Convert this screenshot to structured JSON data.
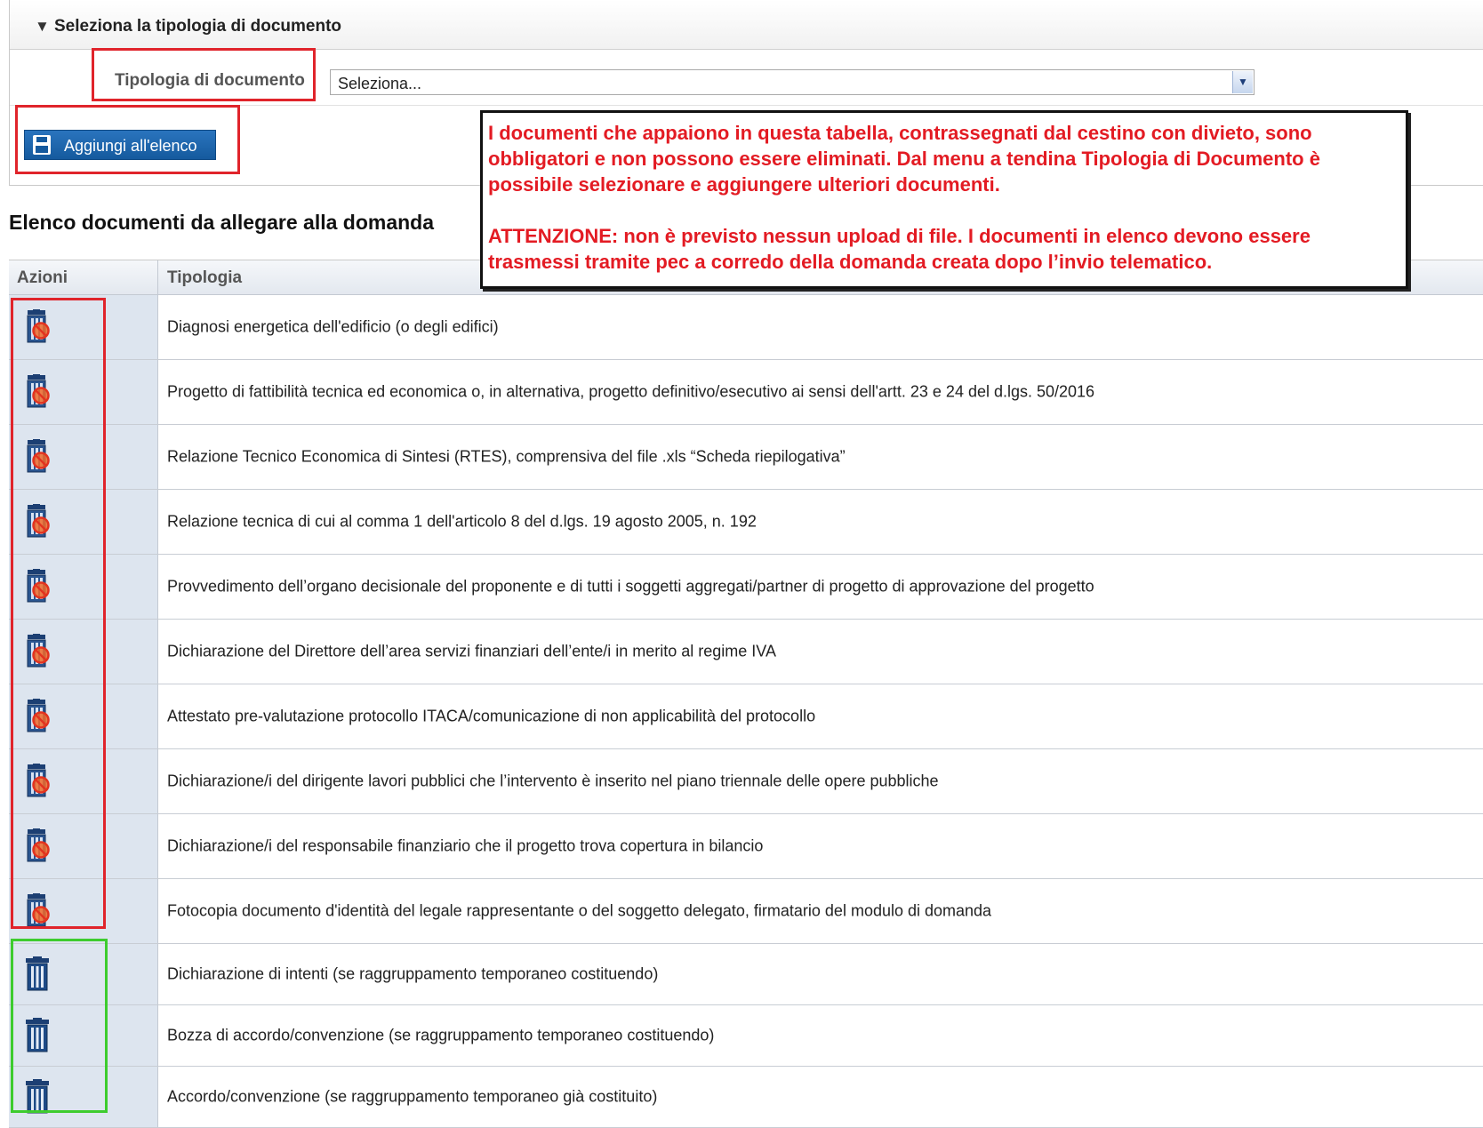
{
  "panel": {
    "header_title": "Seleziona la tipologia di documento",
    "field_label": "Tipologia di documento",
    "select_value": "Seleziona...",
    "add_button_label": "Aggiungi all'elenco"
  },
  "list_title": "Elenco documenti da allegare alla domanda",
  "table": {
    "columns": [
      "Azioni",
      "Tipologia"
    ],
    "rows": [
      {
        "tipologia": "Diagnosi energetica dell'edificio (o degli edifici)",
        "action_icon": "trash-forbidden-icon"
      },
      {
        "tipologia": "Progetto di fattibilità tecnica ed economica o, in alternativa, progetto definitivo/esecutivo ai sensi dell'artt. 23 e 24 del d.lgs. 50/2016",
        "action_icon": "trash-forbidden-icon"
      },
      {
        "tipologia": "Relazione Tecnico Economica di Sintesi (RTES), comprensiva del file .xls “Scheda riepilogativa”",
        "action_icon": "trash-forbidden-icon"
      },
      {
        "tipologia": "Relazione tecnica di cui al comma 1 dell'articolo 8 del d.lgs. 19 agosto 2005, n. 192",
        "action_icon": "trash-forbidden-icon"
      },
      {
        "tipologia": "Provvedimento dell’organo decisionale del proponente e di tutti i soggetti aggregati/partner di progetto di approvazione del progetto",
        "action_icon": "trash-forbidden-icon"
      },
      {
        "tipologia": "Dichiarazione del Direttore dell’area servizi finanziari dell’ente/i in merito al regime IVA",
        "action_icon": "trash-forbidden-icon"
      },
      {
        "tipologia": "Attestato pre-valutazione protocollo ITACA/comunicazione di non applicabilità del protocollo",
        "action_icon": "trash-forbidden-icon"
      },
      {
        "tipologia": "Dichiarazione/i del dirigente lavori pubblici che l’intervento è inserito nel piano triennale delle opere pubbliche",
        "action_icon": "trash-forbidden-icon"
      },
      {
        "tipologia": "Dichiarazione/i del responsabile finanziario che il progetto trova copertura in bilancio",
        "action_icon": "trash-forbidden-icon"
      },
      {
        "tipologia": "Fotocopia documento d'identità del legale rappresentante o del soggetto delegato, firmatario del modulo di domanda",
        "action_icon": "trash-forbidden-icon"
      },
      {
        "tipologia": "Dichiarazione di intenti (se raggruppamento temporaneo costituendo)",
        "action_icon": "trash-icon"
      },
      {
        "tipologia": "Bozza di accordo/convenzione (se raggruppamento temporaneo costituendo)",
        "action_icon": "trash-icon"
      },
      {
        "tipologia": "Accordo/convenzione (se raggruppamento temporaneo già costituito)",
        "action_icon": "trash-icon"
      }
    ]
  },
  "callout": {
    "paragraph1": "I documenti che appaiono in questa tabella, contrassegnati dal cestino con divieto, sono obbligatori e non possono essere eliminati. Dal menu a tendina Tipologia di Documento è possibile selezionare e aggiungere ulteriori documenti.",
    "paragraph2": "ATTENZIONE: non è previsto nessun upload di file. I documenti in elenco devono essere trasmessi tramite pec a corredo della domanda creata dopo l’invio telematico."
  },
  "colors": {
    "highlight_red": "#e0242b",
    "highlight_green": "#3dcc2e",
    "callout_text": "#e31b23",
    "button_blue": "#155a9e",
    "action_column_bg": "#dde5ef"
  }
}
